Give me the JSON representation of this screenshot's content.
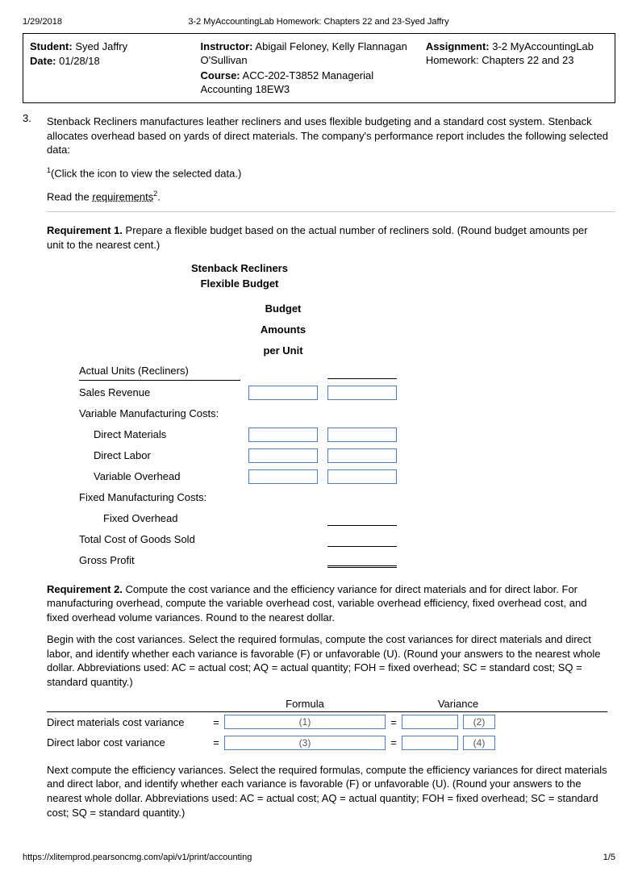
{
  "top": {
    "date_printed": "1/29/2018",
    "doc_title": "3-2 MyAccountingLab Homework: Chapters 22 and 23-Syed Jaffry"
  },
  "info": {
    "student_label": "Student:",
    "student_value": "Syed Jaffry",
    "date_label": "Date:",
    "date_value": "01/28/18",
    "instructor_label": "Instructor:",
    "instructor_value": "Abigail Feloney, Kelly Flannagan O'Sullivan",
    "course_label": "Course:",
    "course_value": "ACC-202-T3852 Managerial Accounting 18EW3",
    "assignment_label": "Assignment:",
    "assignment_value": "3-2 MyAccountingLab Homework: Chapters 22 and 23"
  },
  "question": {
    "number": "3.",
    "text1": "Stenback Recliners manufactures leather recliners and uses flexible budgeting and a standard cost system. Stenback allocates overhead based on yards of direct materials. The company's performance report includes the following selected data:",
    "click_note_pre": "1",
    "click_note": "(Click the icon to view the selected data.)",
    "read_the": "Read the ",
    "requirements": "requirements",
    "req_sup": "2",
    "period": "."
  },
  "req1": {
    "head_bold": "Requirement 1.",
    "head_rest": " Prepare a flexible budget based on the actual number of recliners sold. (Round budget amounts per unit to the nearest cent.)",
    "title1": "Stenback Recliners",
    "title2": "Flexible Budget",
    "colhead1": "Budget",
    "colhead2": "Amounts",
    "colhead3": "per Unit",
    "rows": {
      "actual_units": "Actual Units (Recliners)",
      "sales_rev": "Sales Revenue",
      "vmc": "Variable Manufacturing Costs:",
      "dm": "Direct Materials",
      "dl": "Direct Labor",
      "voh": "Variable Overhead",
      "fmc": "Fixed Manufacturing Costs:",
      "foh": "Fixed Overhead",
      "tcogs": "Total Cost of Goods Sold",
      "gp": "Gross Profit"
    }
  },
  "req2": {
    "head_bold": "Requirement 2.",
    "head_rest": " Compute the cost variance and the efficiency variance for direct materials and for direct labor. For manufacturing overhead, compute the variable overhead cost, variable overhead efficiency, fixed overhead cost, and fixed overhead volume variances. Round to the nearest dollar.",
    "para2": "Begin with the cost variances. Select the required formulas, compute the cost variances for direct materials and direct labor, and identify whether each variance is favorable (F) or unfavorable (U). (Round your answers to the nearest whole dollar. Abbreviations used: AC = actual cost; AQ = actual quantity; FOH = fixed overhead; SC = standard cost; SQ = standard quantity.)",
    "col_formula": "Formula",
    "col_variance": "Variance",
    "row1_label": "Direct materials cost variance",
    "row2_label": "Direct labor cost variance",
    "eq": "=",
    "ph1": "(1)",
    "ph2": "(2)",
    "ph3": "(3)",
    "ph4": "(4)",
    "para3": "Next compute the efficiency variances. Select the required formulas, compute the efficiency variances for direct materials and direct labor, and identify whether each variance is favorable (F) or unfavorable (U). (Round your answers to the nearest whole dollar. Abbreviations used: AC = actual cost; AQ = actual quantity; FOH = fixed overhead; SC = standard cost; SQ = standard quantity.)"
  },
  "footer": {
    "url": "https://xlitemprod.pearsoncmg.com/api/v1/print/accounting",
    "page": "1/5"
  }
}
